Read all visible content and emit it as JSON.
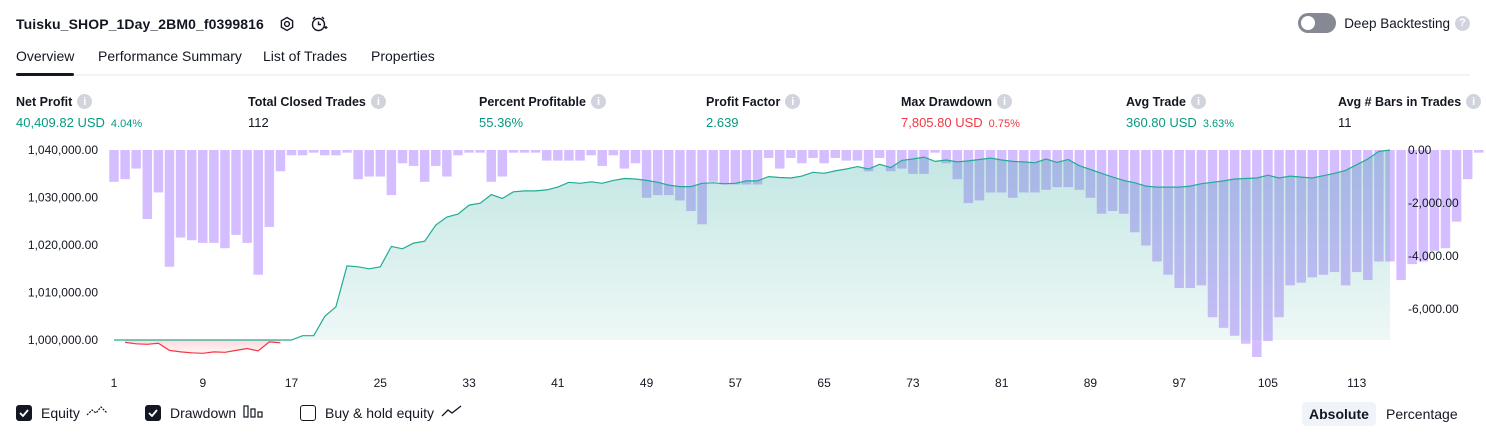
{
  "header": {
    "title": "Tuisku_SHOP_1Day_2BM0_f0399816",
    "icons": [
      "settings-icon",
      "alert-clock-icon"
    ]
  },
  "deep_backtesting": {
    "label": "Deep Backtesting",
    "enabled": false,
    "help": "?"
  },
  "tabs": [
    {
      "label": "Overview",
      "active": true
    },
    {
      "label": "Performance Summary",
      "active": false
    },
    {
      "label": "List of Trades",
      "active": false
    },
    {
      "label": "Properties",
      "active": false
    }
  ],
  "metrics": [
    {
      "label": "Net Profit",
      "value": "40,409.82 USD",
      "pct": "4.04%",
      "color": "#089981"
    },
    {
      "label": "Total Closed Trades",
      "value": "112",
      "pct": "",
      "color": "#131722"
    },
    {
      "label": "Percent Profitable",
      "value": "55.36%",
      "pct": "",
      "color": "#089981"
    },
    {
      "label": "Profit Factor",
      "value": "2.639",
      "pct": "",
      "color": "#089981"
    },
    {
      "label": "Max Drawdown",
      "value": "7,805.80 USD",
      "pct": "0.75%",
      "color": "#f23645"
    },
    {
      "label": "Avg Trade",
      "value": "360.80 USD",
      "pct": "3.63%",
      "color": "#089981"
    },
    {
      "label": "Avg # Bars in Trades",
      "value": "11",
      "pct": "",
      "color": "#131722"
    }
  ],
  "chart_data": {
    "type": "line",
    "x_ticks": [
      "1",
      "9",
      "17",
      "25",
      "33",
      "41",
      "49",
      "57",
      "65",
      "73",
      "81",
      "89",
      "97",
      "105",
      "113"
    ],
    "y_left_ticks": [
      "1,040,000.00",
      "1,030,000.00",
      "1,020,000.00",
      "1,010,000.00",
      "1,000,000.00"
    ],
    "y_right_ticks": [
      "0.00",
      "-2,000.00",
      "-4,000.00",
      "-6,000.00"
    ],
    "ylim_left": [
      996000,
      1040000
    ],
    "ylim_right": [
      -7800,
      0
    ],
    "baseline": 1000000,
    "colors": {
      "equity_line": "#22ab94",
      "equity_fill": "#26a69a",
      "loss_line": "#f23645",
      "loss_fill": "#f7525f",
      "drawdown": "#b388ff"
    },
    "series": [
      {
        "name": "Equity",
        "values": [
          1000000,
          999500,
          999200,
          999100,
          999300,
          997800,
          997500,
          997300,
          997200,
          997500,
          997400,
          997800,
          998200,
          997700,
          999600,
          999400,
          1000000,
          1000900,
          1000900,
          1005000,
          1007000,
          1015600,
          1015400,
          1015000,
          1015400,
          1019700,
          1019200,
          1020400,
          1020800,
          1024200,
          1025900,
          1026500,
          1028400,
          1028800,
          1030600,
          1029800,
          1031200,
          1031400,
          1031400,
          1031600,
          1032200,
          1033200,
          1033000,
          1033300,
          1033000,
          1033600,
          1034000,
          1033900,
          1033600,
          1033200,
          1032600,
          1032300,
          1032300,
          1033000,
          1033100,
          1032900,
          1033000,
          1033500,
          1033500,
          1034400,
          1034200,
          1034100,
          1034500,
          1035300,
          1035100,
          1035600,
          1036000,
          1036500,
          1036000,
          1037000,
          1036300,
          1037800,
          1038100,
          1038500,
          1037600,
          1037900,
          1037500,
          1037700,
          1038000,
          1038300,
          1037900,
          1037600,
          1037500,
          1037300,
          1038100,
          1037400,
          1038000,
          1036700,
          1035900,
          1035100,
          1034300,
          1033600,
          1033100,
          1032400,
          1032200,
          1032200,
          1032200,
          1032400,
          1032900,
          1033200,
          1033500,
          1033900,
          1034000,
          1034100,
          1034700,
          1034100,
          1034500,
          1034300,
          1034100,
          1034600,
          1035100,
          1035700,
          1036900,
          1038100,
          1039700,
          1040000
        ],
        "min_value": 996000
      },
      {
        "name": "Drawdown",
        "values": [
          -1200,
          -1100,
          -700,
          -2600,
          -1600,
          -4400,
          -3300,
          -3400,
          -3500,
          -3500,
          -3700,
          -3200,
          -3500,
          -4700,
          -2900,
          -800,
          -200,
          -200,
          -100,
          -200,
          -200,
          -100,
          -1100,
          -1000,
          -1000,
          -1700,
          -500,
          -600,
          -1200,
          -600,
          -1000,
          -200,
          -100,
          -100,
          -1200,
          -1000,
          -100,
          -100,
          -100,
          -400,
          -400,
          -400,
          -400,
          -200,
          -600,
          -200,
          -700,
          -500,
          -1800,
          -1700,
          -1700,
          -1900,
          -2300,
          -2800,
          -1200,
          -1300,
          -1300,
          -1300,
          -1300,
          -300,
          -700,
          -300,
          -500,
          -300,
          -500,
          -300,
          -400,
          -400,
          -800,
          -300,
          -800,
          -700,
          -900,
          -900,
          -100,
          -500,
          -1100,
          -2000,
          -1900,
          -1600,
          -1600,
          -1800,
          -1600,
          -1600,
          -1500,
          -1400,
          -1400,
          -1500,
          -1800,
          -2400,
          -2300,
          -2400,
          -3100,
          -3600,
          -4200,
          -4700,
          -5200,
          -5200,
          -5100,
          -6300,
          -6700,
          -7000,
          -7300,
          -7800,
          -7200,
          -6300,
          -5100,
          -5000,
          -4800,
          -4700,
          -4600,
          -5100,
          -4600,
          -4900,
          -4200,
          -4200,
          -4900,
          -4300,
          -4200,
          -3800,
          -3700,
          -2700,
          -1100,
          -100,
          0
        ]
      }
    ]
  },
  "legend": [
    {
      "label": "Equity",
      "checked": true,
      "icon": "equity-line-icon"
    },
    {
      "label": "Drawdown",
      "checked": true,
      "icon": "drawdown-bars-icon"
    },
    {
      "label": "Buy & hold equity",
      "checked": false,
      "icon": "buy-hold-line-icon"
    }
  ],
  "scale": {
    "absolute": "Absolute",
    "percentage": "Percentage",
    "selected": "Absolute"
  }
}
